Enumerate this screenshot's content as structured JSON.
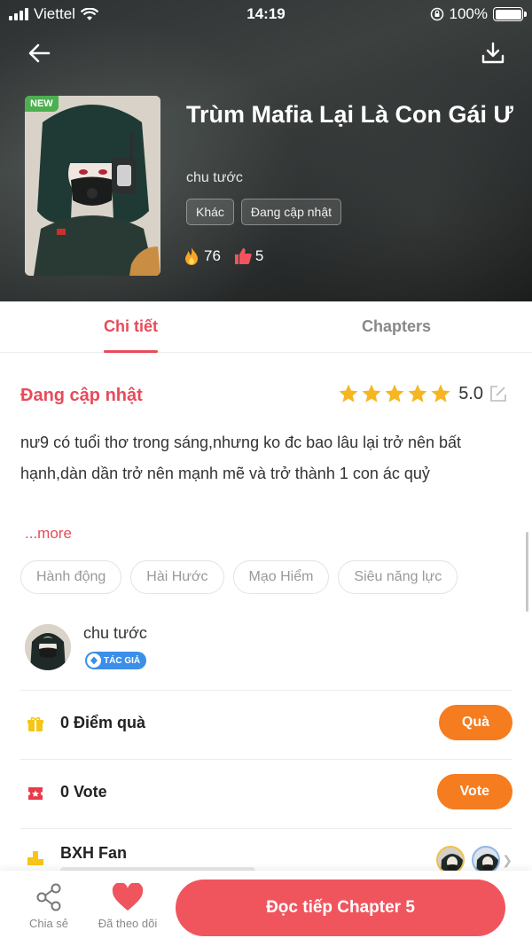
{
  "status_bar": {
    "carrier": "Viettel",
    "time": "14:19",
    "battery": "100%"
  },
  "header": {
    "badge": "NEW",
    "title": "Trùm Mafia Lại Là Con Gái Ư",
    "author": "chu tước",
    "tags": [
      "Khác",
      "Đang cập nhật"
    ],
    "views": "76",
    "likes": "5"
  },
  "tabs": {
    "detail": "Chi tiết",
    "chapters": "Chapters"
  },
  "detail": {
    "status": "Đang cập nhật",
    "rating": "5.0",
    "rating_stars": 5,
    "description": "nư9 có tuổi thơ trong sáng,nhưng ko đc bao lâu lại trở nên bất hạnh,dàn dần trở nên mạnh mẽ và trở thành 1 con ác quỷ",
    "more": "...more",
    "genres": [
      "Hành động",
      "Hài Hước",
      "Mạo Hiểm",
      "Siêu năng lực"
    ]
  },
  "author_card": {
    "name": "chu tước",
    "badge": "TÁC GIẢ"
  },
  "gift": {
    "label": "0 Điểm quà",
    "button": "Quà"
  },
  "vote": {
    "label": "0 Vote",
    "button": "Vote"
  },
  "fan": {
    "title": "BXH Fan"
  },
  "bottom": {
    "share": "Chia sẻ",
    "follow": "Đã theo dõi",
    "read": "Đọc tiếp Chapter 5"
  },
  "colors": {
    "accent": "#e84b5a",
    "orange": "#f57c1f",
    "read_button": "#f0555e",
    "star": "#f5b622",
    "author_badge": "#3b8fe8",
    "new_badge": "#4caf50"
  }
}
